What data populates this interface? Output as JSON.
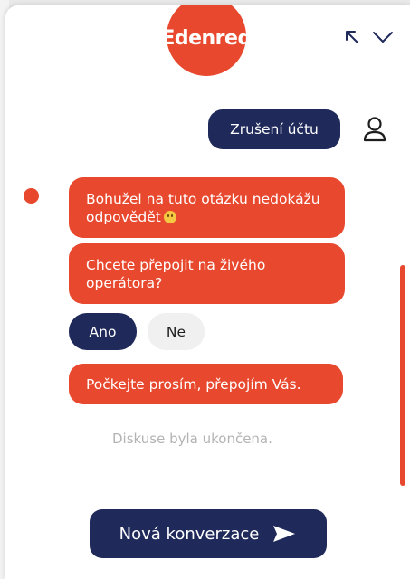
{
  "colors": {
    "brand": "#e8492e",
    "navy": "#1f2a5a",
    "muted": "#b3b3b3"
  },
  "header": {
    "logo_text": "Edenred",
    "expand_icon": "arrow-up-left-icon",
    "collapse_icon": "chevron-down-icon"
  },
  "messages": {
    "user": "Zrušení účtu",
    "bot1": "Bohužel na tuto otázku nedokážu odpovědět",
    "bot2": "Chcete přepojit na živého operátora?",
    "bot3": "Počkejte prosím, přepojím Vás."
  },
  "quick_replies": {
    "yes": "Ano",
    "no": "Ne"
  },
  "status": {
    "ended": "Diskuse byla ukončena."
  },
  "footer": {
    "new_conversation": "Nová konverzace",
    "send_icon": "send-arrow-icon"
  }
}
